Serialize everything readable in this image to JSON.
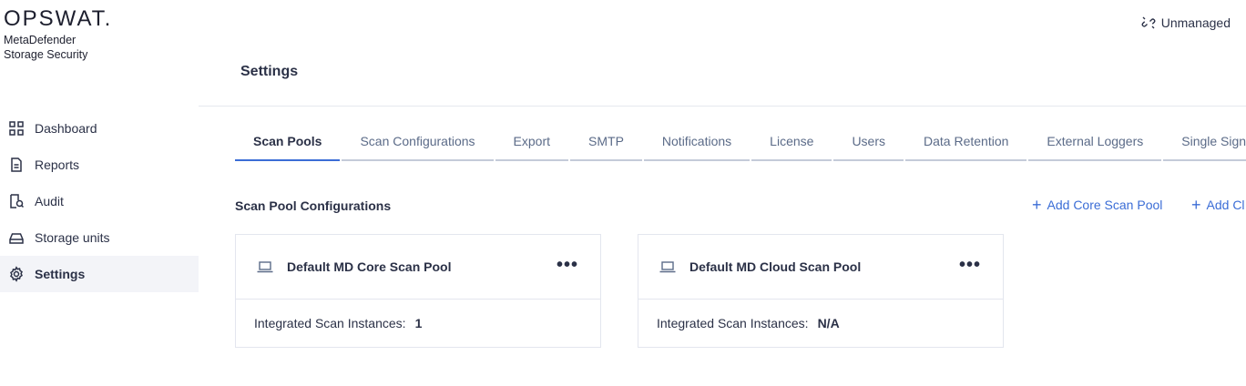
{
  "brand": {
    "wordmark": "OPSWAT.",
    "product_line1": "MetaDefender",
    "product_line2": "Storage Security"
  },
  "sidebar": {
    "items": [
      {
        "label": "Dashboard",
        "icon": "dashboard-icon",
        "active": false
      },
      {
        "label": "Reports",
        "icon": "document-icon",
        "active": false
      },
      {
        "label": "Audit",
        "icon": "audit-icon",
        "active": false
      },
      {
        "label": "Storage units",
        "icon": "storage-icon",
        "active": false
      },
      {
        "label": "Settings",
        "icon": "gear-icon",
        "active": true
      }
    ]
  },
  "header": {
    "status": "Unmanaged",
    "status_icon": "unlink-icon",
    "page_title": "Settings"
  },
  "tabs": [
    {
      "label": "Scan Pools",
      "active": true
    },
    {
      "label": "Scan Configurations"
    },
    {
      "label": "Export"
    },
    {
      "label": "SMTP"
    },
    {
      "label": "Notifications"
    },
    {
      "label": "License"
    },
    {
      "label": "Users"
    },
    {
      "label": "Data Retention"
    },
    {
      "label": "External Loggers"
    },
    {
      "label": "Single Sign On"
    }
  ],
  "section": {
    "title": "Scan Pool Configurations",
    "add_core_label": "Add Core Scan Pool",
    "add_cloud_label": "Add Cl"
  },
  "cards": [
    {
      "title": "Default MD Core Scan Pool",
      "instances_label": "Integrated Scan Instances:",
      "instances_value": "1",
      "menu": "•••"
    },
    {
      "title": "Default MD Cloud Scan Pool",
      "instances_label": "Integrated Scan Instances:",
      "instances_value": "N/A",
      "menu": "•••"
    }
  ],
  "colors": {
    "accent": "#3b6dd6",
    "text": "#2b3147",
    "muted_tab": "#5b6b88",
    "active_nav_bg": "#f3f4f8"
  }
}
